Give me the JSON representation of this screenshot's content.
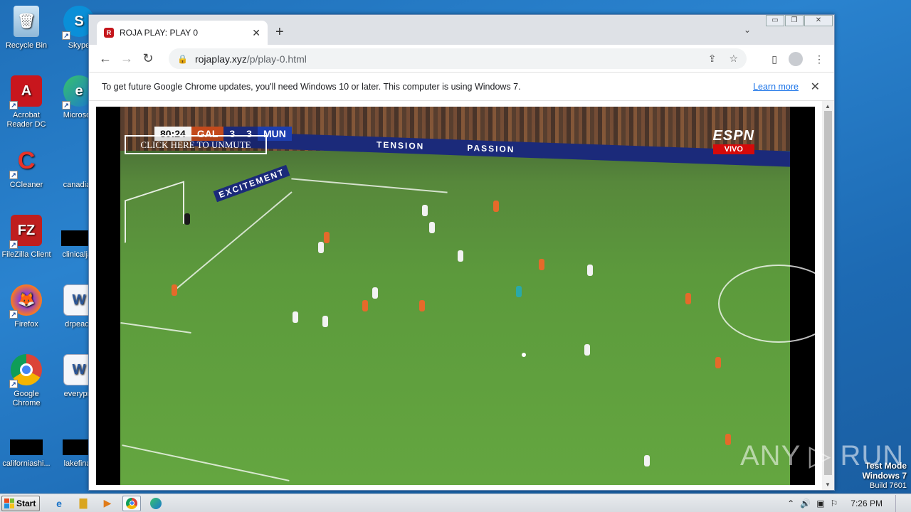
{
  "desktop": {
    "icons": [
      {
        "label": "Recycle Bin"
      },
      {
        "label": "Skype"
      },
      {
        "label": "Acrobat Reader DC"
      },
      {
        "label": "Microsoft"
      },
      {
        "label": "CCleaner"
      },
      {
        "label": "canadian"
      },
      {
        "label": "FileZilla Client"
      },
      {
        "label": "clinicaljac"
      },
      {
        "label": "Firefox"
      },
      {
        "label": "drpeace"
      },
      {
        "label": "Google Chrome"
      },
      {
        "label": "everypre"
      },
      {
        "label": "californiashi..."
      },
      {
        "label": "lakefinall"
      }
    ],
    "test_mode": {
      "line1": "Test Mode",
      "line2": "Windows 7",
      "line3": "Build 7601"
    }
  },
  "browser": {
    "tab": {
      "title": "ROJA PLAY: PLAY 0",
      "favicon_letter": "R"
    },
    "new_tab_symbol": "+",
    "tab_search_symbol": "⌄",
    "window_controls": {
      "minimize": "▭",
      "restore": "❐",
      "close": "✕"
    },
    "nav": {
      "back": "←",
      "forward": "→",
      "reload": "↻"
    },
    "omnibox": {
      "lock": "🔒",
      "host": "rojaplay.xyz",
      "path": "/p/play-0.html",
      "share": "⇪",
      "star": "☆"
    },
    "toolbar_right": {
      "sidepanel": "▯",
      "menu": "⋮"
    },
    "infobar": {
      "message": "To get future Google Chrome updates, you'll need Windows 10 or later. This computer is using Windows 7.",
      "link": "Learn more",
      "close": "✕"
    }
  },
  "video": {
    "scorebug": {
      "clock": "80:24",
      "home": "GAL",
      "home_score": "3",
      "away_score": "3",
      "away": "MUN"
    },
    "unmute_label": "CLICK HERE TO UNMUTE",
    "broadcaster": {
      "brand": "ESPN",
      "live": "VIVO"
    },
    "boards": [
      "EXCITEMENT",
      "TENSION",
      "PASSION"
    ],
    "watermark": "ANY ▷ RUN"
  },
  "taskbar": {
    "start_label": "Start",
    "time": "7:26 PM",
    "tray_icons": [
      "up-arrow",
      "speaker",
      "network",
      "flag"
    ]
  }
}
